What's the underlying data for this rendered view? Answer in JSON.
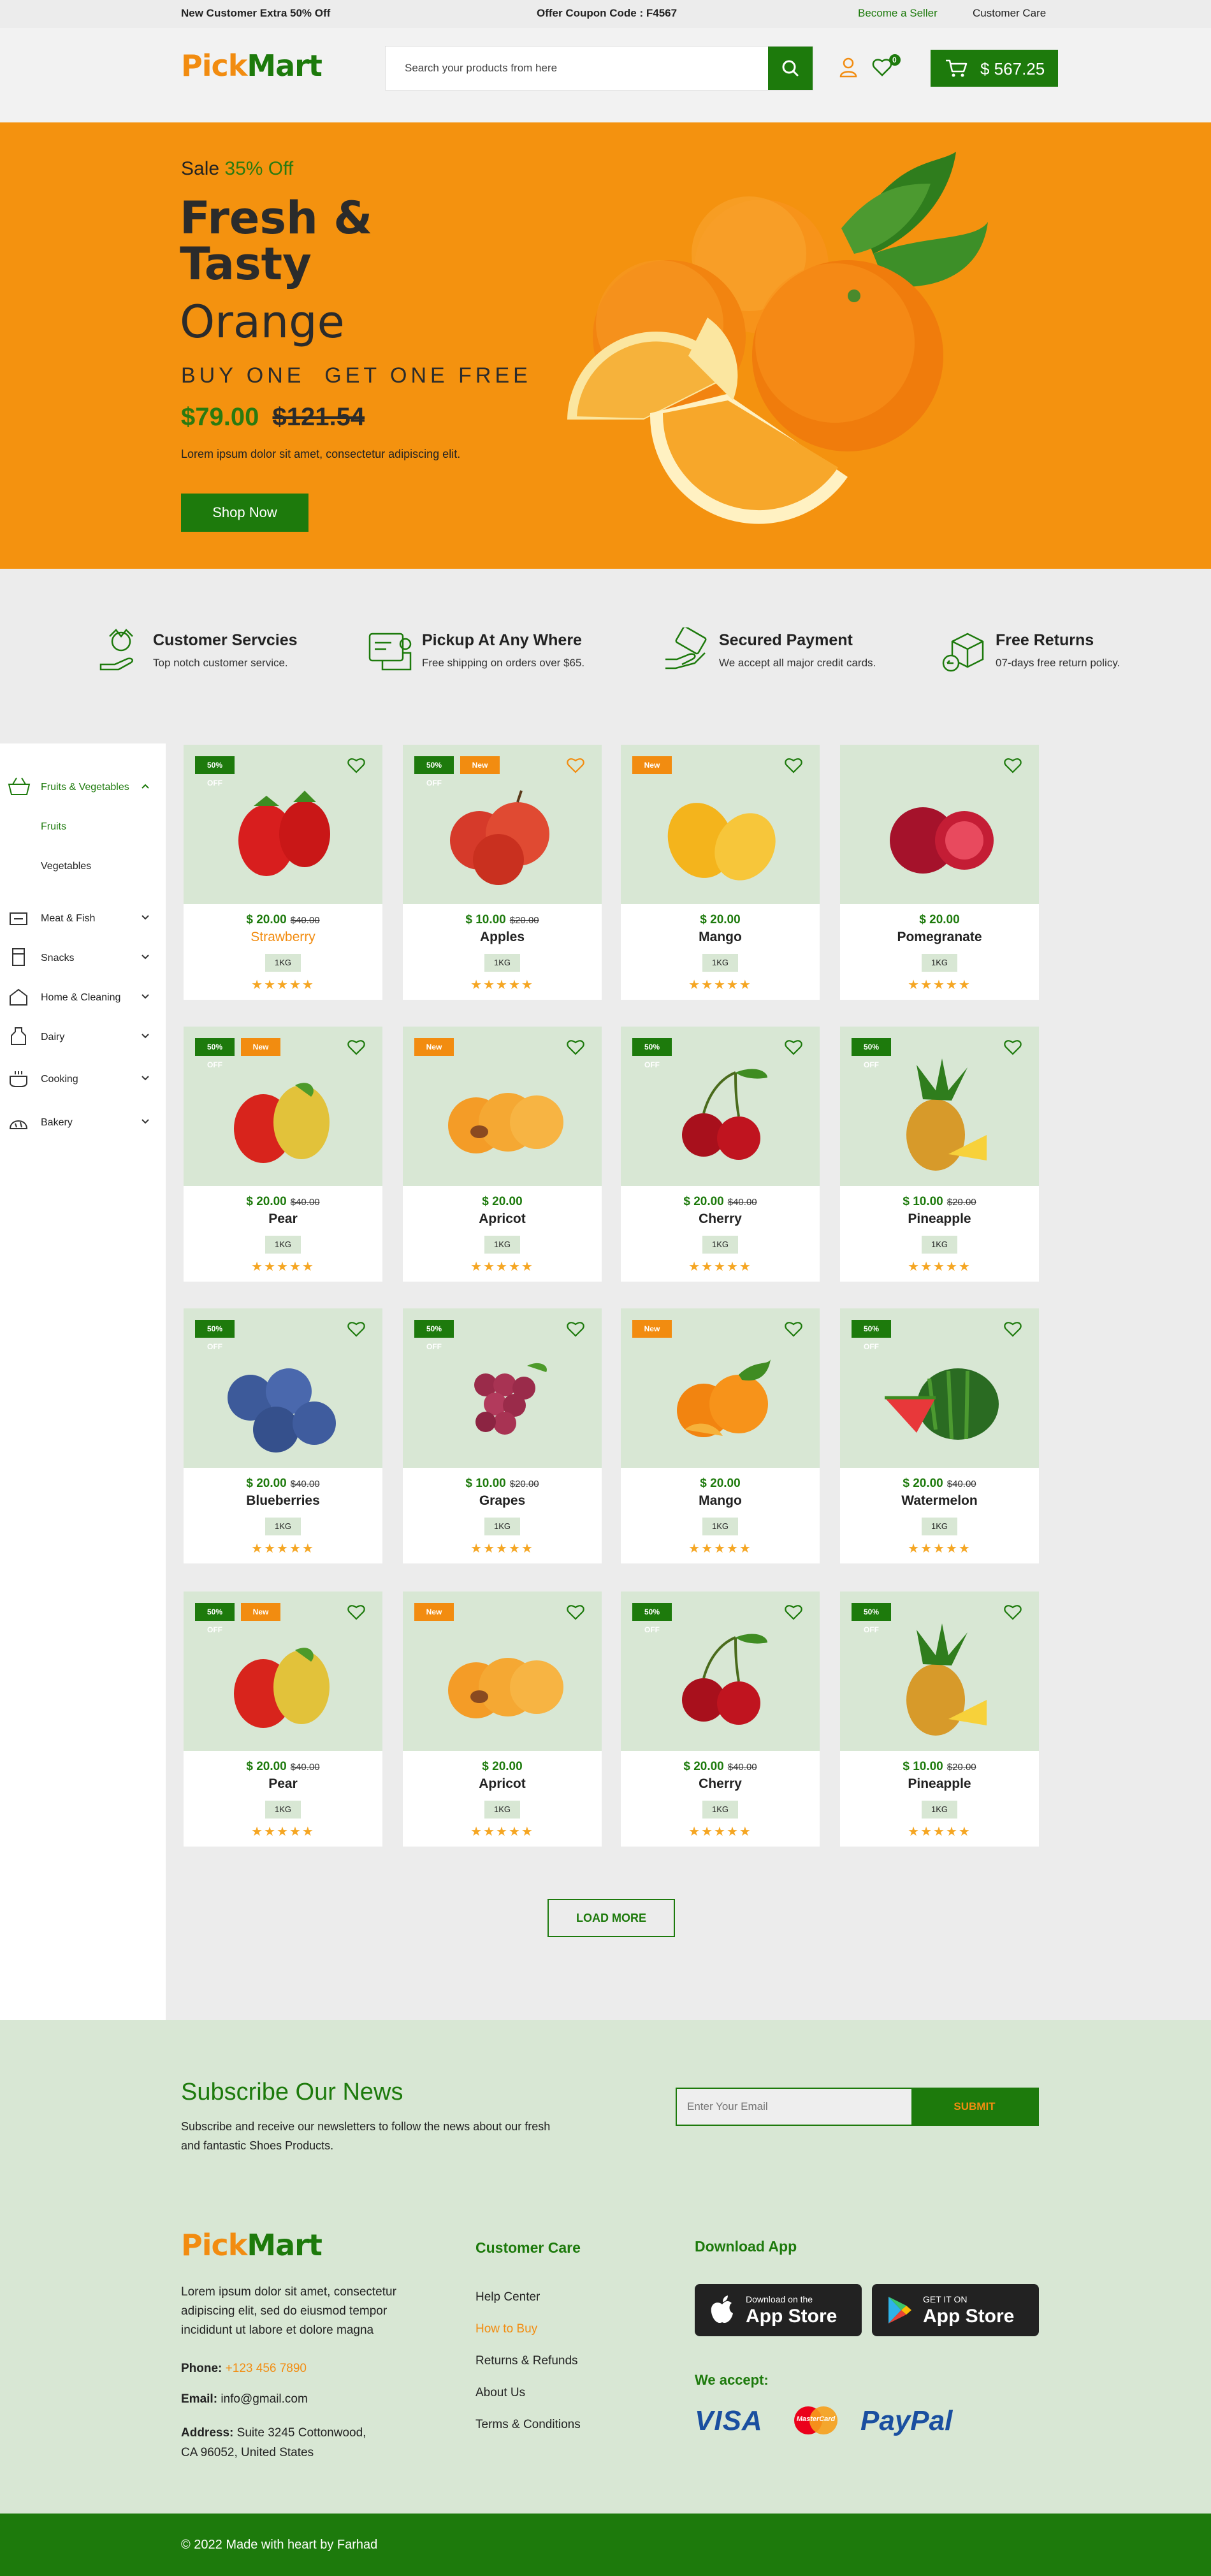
{
  "topbar": {
    "promo": "New Customer Extra 50% Off",
    "coupon_label": "Offer Coupon Code :",
    "coupon_code": "F4567",
    "seller_link": "Become a Seller",
    "care_link": "Customer Care"
  },
  "header": {
    "logo_a": "Pick",
    "logo_b": "Mart",
    "search_placeholder": "Search your products from here",
    "wishlist_count": "0",
    "cart_total": "$ 567.25"
  },
  "hero": {
    "sale_label": "Sale",
    "sale_value": "35% Off",
    "title_line1": "Fresh &",
    "title_line2": "Tasty",
    "subtitle": "Orange",
    "offer": "BUY ONE  GET ONE FREE",
    "price": "$79.00",
    "old_price": "$121.54",
    "description": "Lorem ipsum dolor sit amet, consectetur adipiscing elit.",
    "cta": "Shop Now"
  },
  "features": [
    {
      "title": "Customer Servcies",
      "subtitle": "Top notch customer service.",
      "icon": "customer-service-icon"
    },
    {
      "title": "Pickup At Any Where",
      "subtitle": "Free shipping on orders over $65.",
      "icon": "truck-icon"
    },
    {
      "title": "Secured Payment",
      "subtitle": "We accept all major credit cards.",
      "icon": "secure-payment-icon"
    },
    {
      "title": "Free Returns",
      "subtitle": "07-days free return policy.",
      "icon": "returns-icon"
    }
  ],
  "sidebar": {
    "active": "Fruits & Vegetables",
    "sub_active": "Fruits",
    "sub_other": "Vegetables",
    "items": [
      "Meat & Fish",
      "Snacks",
      "Home & Cleaning",
      "Dairy",
      "Cooking",
      "Bakery"
    ]
  },
  "products": [
    {
      "name": "Strawberry",
      "price": "$ 20.00",
      "old": "$40.00",
      "weight": "1KG",
      "badges": [
        "50% OFF"
      ],
      "fruit": "strawberry",
      "highlight": true,
      "heart_active": false
    },
    {
      "name": "Apples",
      "price": "$ 10.00",
      "old": "$20.00",
      "weight": "1KG",
      "badges": [
        "50% OFF",
        "New"
      ],
      "fruit": "apple",
      "highlight": false,
      "heart_active": true
    },
    {
      "name": "Mango",
      "price": "$ 20.00",
      "old": "",
      "weight": "1KG",
      "badges": [
        "New"
      ],
      "fruit": "mango",
      "highlight": false,
      "heart_active": false
    },
    {
      "name": "Pomegranate",
      "price": "$ 20.00",
      "old": "",
      "weight": "1KG",
      "badges": [],
      "fruit": "pomegranate",
      "highlight": false,
      "heart_active": false
    },
    {
      "name": "Pear",
      "price": "$ 20.00",
      "old": "$40.00",
      "weight": "1KG",
      "badges": [
        "50% OFF",
        "New"
      ],
      "fruit": "pear",
      "highlight": false,
      "heart_active": false
    },
    {
      "name": "Apricot",
      "price": "$ 20.00",
      "old": "",
      "weight": "1KG",
      "badges": [
        "New"
      ],
      "fruit": "apricot",
      "highlight": false,
      "heart_active": false
    },
    {
      "name": "Cherry",
      "price": "$ 20.00",
      "old": "$40.00",
      "weight": "1KG",
      "badges": [
        "50% OFF"
      ],
      "fruit": "cherry",
      "highlight": false,
      "heart_active": false
    },
    {
      "name": "Pineapple",
      "price": "$ 10.00",
      "old": "$20.00",
      "weight": "1KG",
      "badges": [
        "50% OFF"
      ],
      "fruit": "pineapple",
      "highlight": false,
      "heart_active": false
    },
    {
      "name": "Blueberries",
      "price": "$ 20.00",
      "old": "$40.00",
      "weight": "1KG",
      "badges": [
        "50% OFF"
      ],
      "fruit": "blueberry",
      "highlight": false,
      "heart_active": false
    },
    {
      "name": "Grapes",
      "price": "$ 10.00",
      "old": "$20.00",
      "weight": "1KG",
      "badges": [
        "50% OFF"
      ],
      "fruit": "grape",
      "highlight": false,
      "heart_active": false
    },
    {
      "name": "Mango",
      "price": "$ 20.00",
      "old": "",
      "weight": "1KG",
      "badges": [
        "New"
      ],
      "fruit": "orange",
      "highlight": false,
      "heart_active": false
    },
    {
      "name": "Watermelon",
      "price": "$ 20.00",
      "old": "$40.00",
      "weight": "1KG",
      "badges": [
        "50% OFF"
      ],
      "fruit": "watermelon",
      "highlight": false,
      "heart_active": false
    },
    {
      "name": "Pear",
      "price": "$ 20.00",
      "old": "$40.00",
      "weight": "1KG",
      "badges": [
        "50% OFF",
        "New"
      ],
      "fruit": "pear",
      "highlight": false,
      "heart_active": false
    },
    {
      "name": "Apricot",
      "price": "$ 20.00",
      "old": "",
      "weight": "1KG",
      "badges": [
        "New"
      ],
      "fruit": "apricot",
      "highlight": false,
      "heart_active": false
    },
    {
      "name": "Cherry",
      "price": "$ 20.00",
      "old": "$40.00",
      "weight": "1KG",
      "badges": [
        "50% OFF"
      ],
      "fruit": "cherry",
      "highlight": false,
      "heart_active": false
    },
    {
      "name": "Pineapple",
      "price": "$ 10.00",
      "old": "$20.00",
      "weight": "1KG",
      "badges": [
        "50% OFF"
      ],
      "fruit": "pineapple",
      "highlight": false,
      "heart_active": false
    }
  ],
  "rating": 5,
  "load_more": "LOAD MORE",
  "subscribe": {
    "title": "Subscribe Our News",
    "text_line1": "Subscribe and receive our newsletters to follow the news about our fresh",
    "text_line2": "and fantastic Shoes Products.",
    "placeholder": "Enter Your Email",
    "button": "SUBMIT"
  },
  "footer": {
    "about_line1": "Lorem ipsum dolor sit amet, consectetur",
    "about_line2": "adipiscing elit, sed do eiusmod tempor",
    "about_line3": "incididunt ut labore et dolore magna",
    "phone_label": "Phone:",
    "phone": "+123 456 7890",
    "email_label": "Email:",
    "email": "info@gmail.com",
    "address_label": "Address:",
    "address_line1": "Suite 3245 Cottonwood,",
    "address_line2": "CA 96052, United States",
    "care_title": "Customer Care",
    "care_links": [
      "Help Center",
      "How to Buy",
      "Returns & Refunds",
      "About Us",
      "Terms & Conditions"
    ],
    "download_title": "Download App",
    "appstore_small": "Download on the",
    "appstore_big": "App Store",
    "playstore_small": "GET IT ON",
    "playstore_big": "App Store",
    "accept_title": "We accept:",
    "visa": "VISA",
    "mastercard": "MasterCard",
    "paypal": "PayPal",
    "copyright": "© 2022 Made with heart by Farhad"
  },
  "colors": {
    "green": "#1d7a0c",
    "orange": "#f28c10",
    "light_green": "#d8e7d4",
    "hero_bg": "#f4920f"
  }
}
